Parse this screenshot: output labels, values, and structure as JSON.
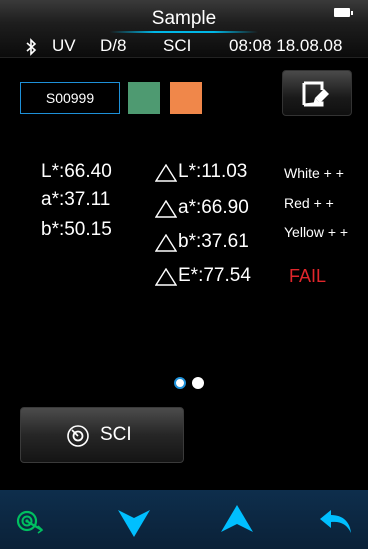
{
  "header": {
    "title": "Sample",
    "mode": "UV",
    "geometry": "D/8",
    "specular": "SCI",
    "datetime": "08:08 18.08.08"
  },
  "sample": {
    "name": "S00999",
    "swatch_colors": [
      "#4e9a71",
      "#f0874a"
    ]
  },
  "measurement": {
    "L": "L*:66.40",
    "a": "a*:37.11",
    "b": "b*:50.15"
  },
  "difference": {
    "dL": "L*:11.03",
    "da": "a*:66.90",
    "db": "b*:37.61",
    "dE": "E*:77.54"
  },
  "assessment": {
    "lightness": "White + +",
    "red_green": "Red + +",
    "yellow_blue": "Yellow + +",
    "result": "FAIL"
  },
  "pager": {
    "current_page": 1,
    "total_pages": 2
  },
  "sci_button": {
    "label": "SCI"
  },
  "colors": {
    "accent": "#1e90d8",
    "nav_icon": "#00bfff",
    "fail": "#e1262b",
    "nav_bg": "#0e2e4c"
  },
  "nav_icons": [
    "measure-target-icon",
    "arrow-down-icon",
    "arrow-up-icon",
    "back-icon"
  ]
}
